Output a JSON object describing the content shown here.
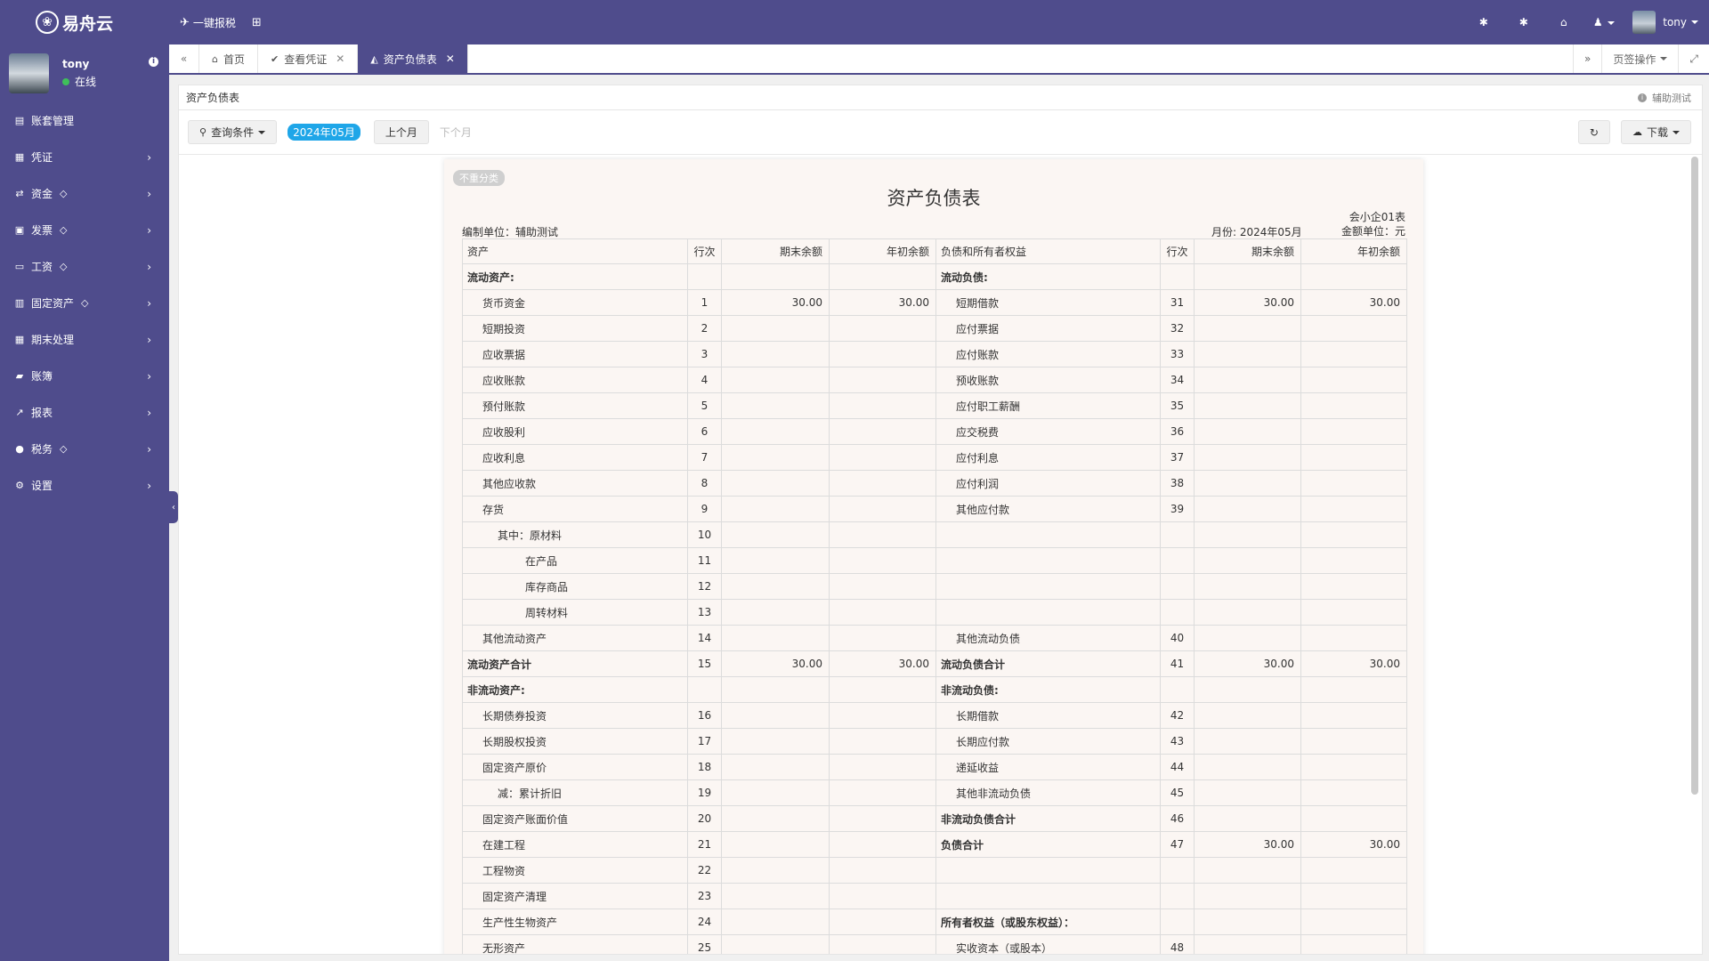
{
  "app": {
    "name": "易舟云",
    "quick_tax_label": "一键报税",
    "top_username": "tony"
  },
  "sidebar": {
    "user": {
      "name": "tony",
      "status": "在线"
    },
    "items": [
      {
        "label": "账套管理",
        "icon": "book-icon",
        "gem": false,
        "chevron": false
      },
      {
        "label": "凭证",
        "icon": "voucher-icon",
        "gem": false,
        "chevron": true
      },
      {
        "label": "资金",
        "icon": "exchange-icon",
        "gem": true,
        "chevron": true
      },
      {
        "label": "发票",
        "icon": "invoice-icon",
        "gem": true,
        "chevron": true
      },
      {
        "label": "工资",
        "icon": "card-icon",
        "gem": true,
        "chevron": true
      },
      {
        "label": "固定资产",
        "icon": "building-icon",
        "gem": true,
        "chevron": true
      },
      {
        "label": "期末处理",
        "icon": "calendar-icon",
        "gem": false,
        "chevron": true
      },
      {
        "label": "账簿",
        "icon": "ledger-icon",
        "gem": false,
        "chevron": true
      },
      {
        "label": "报表",
        "icon": "chart-icon",
        "gem": false,
        "chevron": true
      },
      {
        "label": "税务",
        "icon": "tax-icon",
        "gem": true,
        "chevron": true
      },
      {
        "label": "设置",
        "icon": "gear-icon",
        "gem": false,
        "chevron": true
      }
    ]
  },
  "tabs": [
    {
      "label": "首页",
      "icon": "home-icon",
      "closable": false,
      "active": false
    },
    {
      "label": "查看凭证",
      "icon": "check-circle-icon",
      "closable": true,
      "active": false
    },
    {
      "label": "资产负债表",
      "icon": "area-chart-icon",
      "closable": true,
      "active": true
    }
  ],
  "tab_ops_label": "页签操作",
  "panel": {
    "title": "资产负债表",
    "helper": "辅助测试"
  },
  "toolbar": {
    "query_label": "查询条件",
    "period": "2024年05月",
    "prev_label": "上个月",
    "next_label": "下个月",
    "download_label": "下载"
  },
  "report": {
    "tag": "不重分类",
    "title": "资产负债表",
    "form_no": "会小企01表",
    "unit": "编制单位：辅助测试",
    "month": "月份: 2024年05月",
    "currency": "金额单位：元",
    "headers": [
      "资产",
      "行次",
      "期末余额",
      "年初余额",
      "负债和所有者权益",
      "行次",
      "期末余额",
      "年初余额"
    ],
    "rows": [
      {
        "a": "流动资产:",
        "ai": 0,
        "ab": true,
        "al": "",
        "ae": "",
        "as": "",
        "l": "流动负债:",
        "li": 0,
        "lb": true,
        "ll": "",
        "le": "",
        "ls": ""
      },
      {
        "a": "货币资金",
        "ai": 1,
        "ab": false,
        "al": "1",
        "ae": "30.00",
        "as": "30.00",
        "l": "短期借款",
        "li": 1,
        "lb": false,
        "ll": "31",
        "le": "30.00",
        "ls": "30.00"
      },
      {
        "a": "短期投资",
        "ai": 1,
        "ab": false,
        "al": "2",
        "ae": "",
        "as": "",
        "l": "应付票据",
        "li": 1,
        "lb": false,
        "ll": "32",
        "le": "",
        "ls": ""
      },
      {
        "a": "应收票据",
        "ai": 1,
        "ab": false,
        "al": "3",
        "ae": "",
        "as": "",
        "l": "应付账款",
        "li": 1,
        "lb": false,
        "ll": "33",
        "le": "",
        "ls": ""
      },
      {
        "a": "应收账款",
        "ai": 1,
        "ab": false,
        "al": "4",
        "ae": "",
        "as": "",
        "l": "预收账款",
        "li": 1,
        "lb": false,
        "ll": "34",
        "le": "",
        "ls": ""
      },
      {
        "a": "预付账款",
        "ai": 1,
        "ab": false,
        "al": "5",
        "ae": "",
        "as": "",
        "l": "应付职工薪酬",
        "li": 1,
        "lb": false,
        "ll": "35",
        "le": "",
        "ls": ""
      },
      {
        "a": "应收股利",
        "ai": 1,
        "ab": false,
        "al": "6",
        "ae": "",
        "as": "",
        "l": "应交税费",
        "li": 1,
        "lb": false,
        "ll": "36",
        "le": "",
        "ls": ""
      },
      {
        "a": "应收利息",
        "ai": 1,
        "ab": false,
        "al": "7",
        "ae": "",
        "as": "",
        "l": "应付利息",
        "li": 1,
        "lb": false,
        "ll": "37",
        "le": "",
        "ls": ""
      },
      {
        "a": "其他应收款",
        "ai": 1,
        "ab": false,
        "al": "8",
        "ae": "",
        "as": "",
        "l": "应付利润",
        "li": 1,
        "lb": false,
        "ll": "38",
        "le": "",
        "ls": ""
      },
      {
        "a": "存货",
        "ai": 1,
        "ab": false,
        "al": "9",
        "ae": "",
        "as": "",
        "l": "其他应付款",
        "li": 1,
        "lb": false,
        "ll": "39",
        "le": "",
        "ls": ""
      },
      {
        "a": "其中：原材料",
        "ai": 2,
        "ab": false,
        "al": "10",
        "ae": "",
        "as": "",
        "l": "",
        "li": 0,
        "lb": false,
        "ll": "",
        "le": "",
        "ls": ""
      },
      {
        "a": "在产品",
        "ai": 3,
        "ab": false,
        "al": "11",
        "ae": "",
        "as": "",
        "l": "",
        "li": 0,
        "lb": false,
        "ll": "",
        "le": "",
        "ls": ""
      },
      {
        "a": "库存商品",
        "ai": 3,
        "ab": false,
        "al": "12",
        "ae": "",
        "as": "",
        "l": "",
        "li": 0,
        "lb": false,
        "ll": "",
        "le": "",
        "ls": ""
      },
      {
        "a": "周转材料",
        "ai": 3,
        "ab": false,
        "al": "13",
        "ae": "",
        "as": "",
        "l": "",
        "li": 0,
        "lb": false,
        "ll": "",
        "le": "",
        "ls": ""
      },
      {
        "a": "其他流动资产",
        "ai": 1,
        "ab": false,
        "al": "14",
        "ae": "",
        "as": "",
        "l": "其他流动负债",
        "li": 1,
        "lb": false,
        "ll": "40",
        "le": "",
        "ls": ""
      },
      {
        "a": "流动资产合计",
        "ai": 0,
        "ab": true,
        "al": "15",
        "ae": "30.00",
        "as": "30.00",
        "l": "流动负债合计",
        "li": 0,
        "lb": true,
        "ll": "41",
        "le": "30.00",
        "ls": "30.00"
      },
      {
        "a": "非流动资产:",
        "ai": 0,
        "ab": true,
        "al": "",
        "ae": "",
        "as": "",
        "l": "非流动负债:",
        "li": 0,
        "lb": true,
        "ll": "",
        "le": "",
        "ls": ""
      },
      {
        "a": "长期债券投资",
        "ai": 1,
        "ab": false,
        "al": "16",
        "ae": "",
        "as": "",
        "l": "长期借款",
        "li": 1,
        "lb": false,
        "ll": "42",
        "le": "",
        "ls": ""
      },
      {
        "a": "长期股权投资",
        "ai": 1,
        "ab": false,
        "al": "17",
        "ae": "",
        "as": "",
        "l": "长期应付款",
        "li": 1,
        "lb": false,
        "ll": "43",
        "le": "",
        "ls": ""
      },
      {
        "a": "固定资产原价",
        "ai": 1,
        "ab": false,
        "al": "18",
        "ae": "",
        "as": "",
        "l": "递延收益",
        "li": 1,
        "lb": false,
        "ll": "44",
        "le": "",
        "ls": ""
      },
      {
        "a": "减：累计折旧",
        "ai": 2,
        "ab": false,
        "al": "19",
        "ae": "",
        "as": "",
        "l": "其他非流动负债",
        "li": 1,
        "lb": false,
        "ll": "45",
        "le": "",
        "ls": ""
      },
      {
        "a": "固定资产账面价值",
        "ai": 1,
        "ab": false,
        "al": "20",
        "ae": "",
        "as": "",
        "l": "非流动负债合计",
        "li": 0,
        "lb": true,
        "ll": "46",
        "le": "",
        "ls": ""
      },
      {
        "a": "在建工程",
        "ai": 1,
        "ab": false,
        "al": "21",
        "ae": "",
        "as": "",
        "l": "负债合计",
        "li": 0,
        "lb": true,
        "ll": "47",
        "le": "30.00",
        "ls": "30.00"
      },
      {
        "a": "工程物资",
        "ai": 1,
        "ab": false,
        "al": "22",
        "ae": "",
        "as": "",
        "l": "",
        "li": 0,
        "lb": false,
        "ll": "",
        "le": "",
        "ls": ""
      },
      {
        "a": "固定资产清理",
        "ai": 1,
        "ab": false,
        "al": "23",
        "ae": "",
        "as": "",
        "l": "",
        "li": 0,
        "lb": false,
        "ll": "",
        "le": "",
        "ls": ""
      },
      {
        "a": "生产性生物资产",
        "ai": 1,
        "ab": false,
        "al": "24",
        "ae": "",
        "as": "",
        "l": "所有者权益（或股东权益）：",
        "li": 0,
        "lb": true,
        "ll": "",
        "le": "",
        "ls": ""
      },
      {
        "a": "无形资产",
        "ai": 1,
        "ab": false,
        "al": "25",
        "ae": "",
        "as": "",
        "l": "实收资本（或股本）",
        "li": 1,
        "lb": false,
        "ll": "48",
        "le": "",
        "ls": ""
      }
    ]
  },
  "colors": {
    "primary": "#4f4c8c",
    "period_badge": "#1fa6e8",
    "sheet_bg": "#fbf6f3",
    "online_dot": "#3fbf5a"
  }
}
